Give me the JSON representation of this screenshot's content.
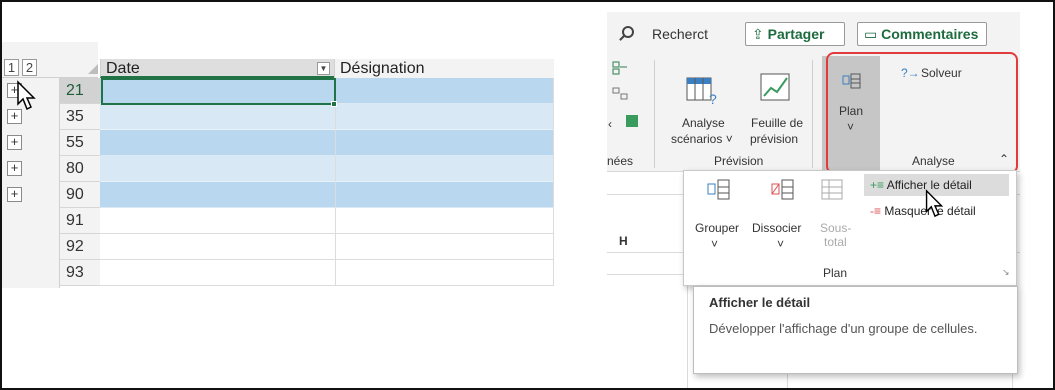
{
  "sheet": {
    "outline_levels": [
      "1",
      "2"
    ],
    "columns": [
      {
        "label": "Date",
        "has_filter": true
      },
      {
        "label": "Désignation",
        "has_filter": false
      }
    ],
    "rows": [
      {
        "num": "21",
        "shade": "blue",
        "expand": true,
        "selected": true
      },
      {
        "num": "35",
        "shade": "lightblue",
        "expand": true
      },
      {
        "num": "55",
        "shade": "blue",
        "expand": true
      },
      {
        "num": "80",
        "shade": "lightblue",
        "expand": true
      },
      {
        "num": "90",
        "shade": "blue",
        "expand": true
      },
      {
        "num": "91",
        "shade": "none",
        "expand": false
      },
      {
        "num": "92",
        "shade": "none",
        "expand": false
      },
      {
        "num": "93",
        "shade": "none",
        "expand": false
      }
    ],
    "expand_symbol": "+",
    "accent_color": "#217346"
  },
  "ribbon": {
    "search_label": "Recherct",
    "share_label": "Partager",
    "comments_label": "Commentaires",
    "analyse_scenarios_line1": "Analyse",
    "analyse_scenarios_line2": "scénarios ˅",
    "feuille_line1": "Feuille de",
    "feuille_line2": "prévision",
    "group_nees": "nées",
    "group_prevision": "Prévision",
    "plan_label": "Plan",
    "solveur_label": "Solveur",
    "group_analyse": "Analyse",
    "column_h": "H",
    "highlight_color": "#e23b3b"
  },
  "plan_menu": {
    "grouper_label": "Grouper",
    "dissocier_label": "Dissocier",
    "sous_total_line1": "Sous-",
    "sous_total_line2": "total",
    "show_detail_label": "Afficher le détail",
    "hide_detail_label": "Masquer le détail",
    "group_label": "Plan"
  },
  "tooltip": {
    "title": "Afficher le détail",
    "body": "Développer l'affichage d'un groupe de cellules."
  }
}
